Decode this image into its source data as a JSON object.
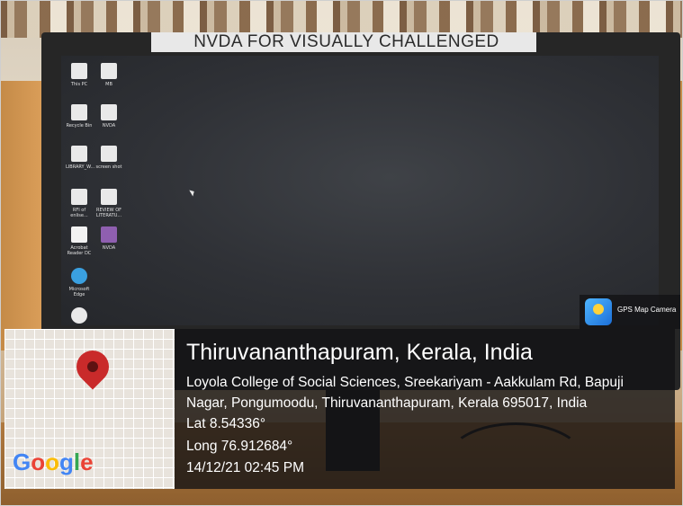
{
  "photo": {
    "monitor_label": "NVDA FOR VISUALLY CHALLENGED",
    "desktop_icons": [
      {
        "label": "This PC"
      },
      {
        "label": "MB"
      },
      {
        "label": "Recycle Bin"
      },
      {
        "label": "NVDA"
      },
      {
        "label": "LIBRARY_W..."
      },
      {
        "label": "screen shot"
      },
      {
        "label": "RFI of enlise..."
      },
      {
        "label": "REVIEW OF LITERATU..."
      },
      {
        "label": "Acrobat Reader DC"
      },
      {
        "label": "NVDA"
      },
      {
        "label": "Microsoft Edge"
      },
      {
        "label": ""
      }
    ]
  },
  "gps_overlay": {
    "app_badge": "GPS Map Camera",
    "map_brand": [
      "G",
      "o",
      "o",
      "g",
      "l",
      "e"
    ],
    "brand_colors": [
      "#4285F4",
      "#EA4335",
      "#FBBC05",
      "#4285F4",
      "#34A853",
      "#EA4335"
    ],
    "location_title": "Thiruvananthapuram, Kerala, India",
    "address_line_1": "Loyola College of Social Sciences, Sreekariyam - Aakkulam Rd, Bapuji",
    "address_line_2": "Nagar, Pongumoodu, Thiruvananthapuram, Kerala 695017, India",
    "latitude": "Lat 8.54336°",
    "longitude": "Long 76.912684°",
    "datetime": "14/12/21 02:45 PM"
  }
}
